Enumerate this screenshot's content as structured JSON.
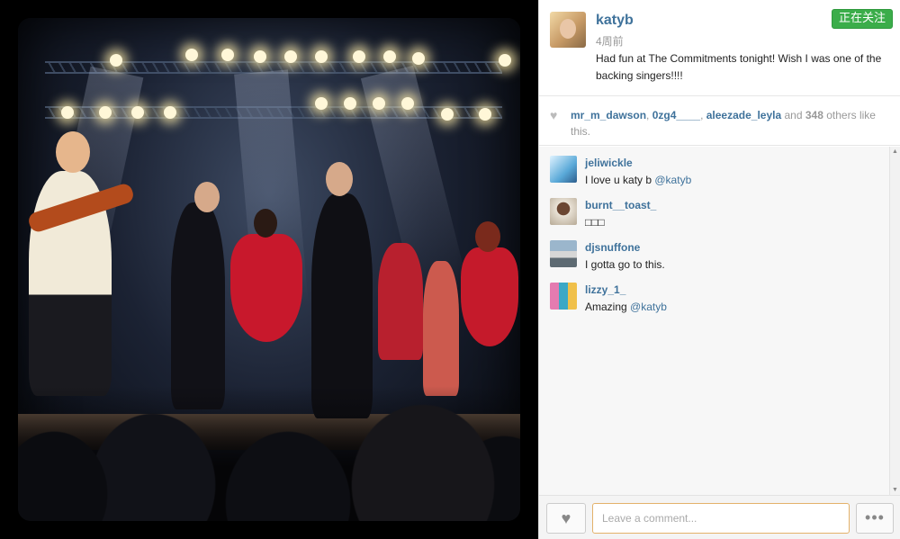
{
  "post": {
    "owner": "katyb",
    "time": "4周前",
    "follow_label": "正在关注",
    "caption": "Had fun at The Commitments tonight! Wish I was one of the backing singers!!!!"
  },
  "likes": {
    "users": [
      "mr_m_dawson",
      "0zg4____",
      "aleezade_leyla"
    ],
    "and": "and",
    "count": "348",
    "others": "others",
    "suffix": "like this."
  },
  "comments": [
    {
      "user": "jeliwickle",
      "text": "I love u katy b ",
      "mention": "@katyb"
    },
    {
      "user": "burnt__toast_",
      "text": "□□□",
      "mention": ""
    },
    {
      "user": "djsnuffone",
      "text": "I gotta go to this.",
      "mention": ""
    },
    {
      "user": "lizzy_1_",
      "text": "Amazing ",
      "mention": "@katyb"
    }
  ],
  "footer": {
    "comment_placeholder": "Leave a comment...",
    "heart_icon": "heart-icon",
    "more_icon": "ellipsis-icon"
  },
  "colors": {
    "link": "#3f729b",
    "follow": "#3bad4a",
    "input_border": "#e3b26a"
  }
}
